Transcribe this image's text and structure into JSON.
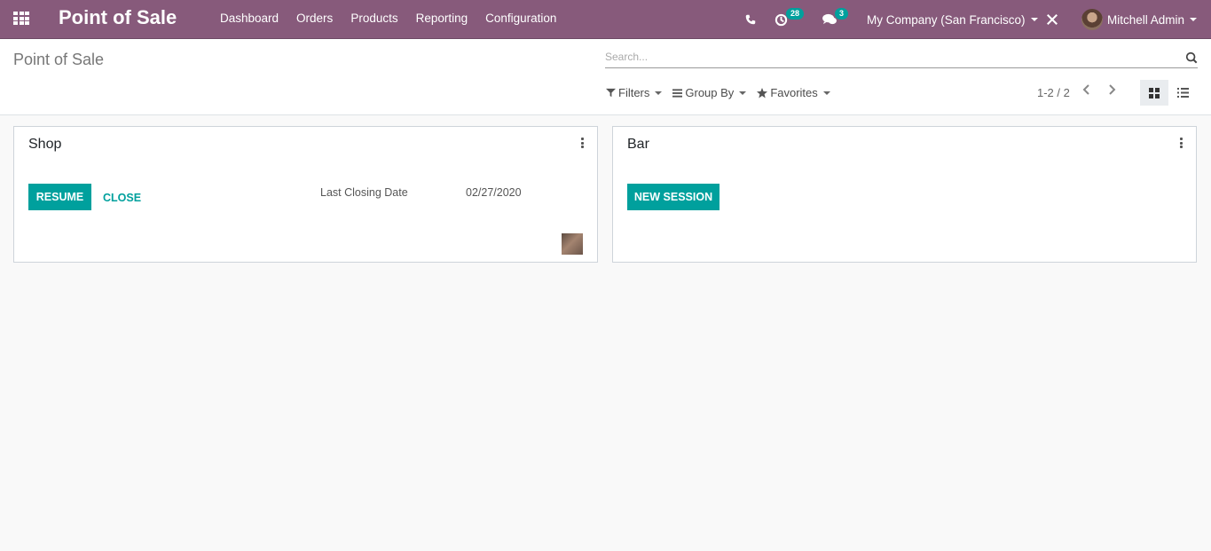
{
  "navbar": {
    "app_title": "Point of Sale",
    "menu": [
      "Dashboard",
      "Orders",
      "Products",
      "Reporting",
      "Configuration"
    ],
    "activity_count": "28",
    "messages_count": "3",
    "company": "My Company (San Francisco)",
    "user": "Mitchell Admin",
    "colors": {
      "brand": "#875a7b",
      "accent": "#00a09d"
    }
  },
  "control_panel": {
    "breadcrumb": "Point of Sale",
    "search_placeholder": "Search...",
    "filters_label": "Filters",
    "group_by_label": "Group By",
    "favorites_label": "Favorites",
    "pager": "1-2 / 2",
    "view_modes": [
      "kanban",
      "list"
    ],
    "active_view": "kanban"
  },
  "cards": [
    {
      "title": "Shop",
      "primary_button": "RESUME",
      "secondary_button": "CLOSE",
      "meta_label": "Last Closing Date",
      "meta_value": "02/27/2020"
    },
    {
      "title": "Bar",
      "primary_button": "NEW SESSION"
    }
  ]
}
